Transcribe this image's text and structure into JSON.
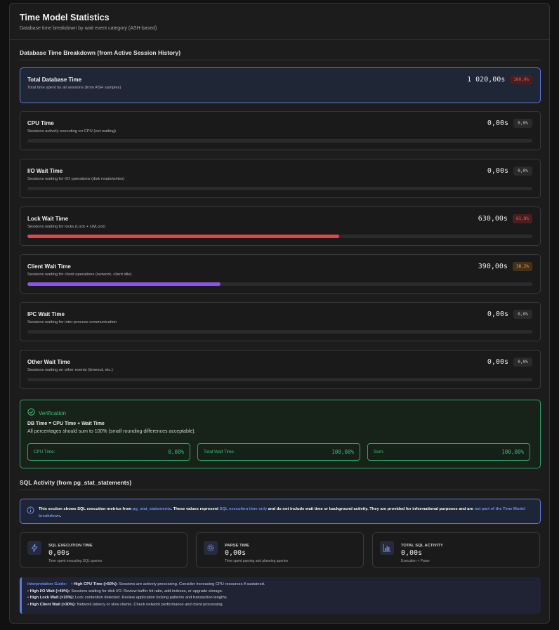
{
  "header": {
    "title": "Time Model Statistics",
    "subtitle": "Database time breakdown by wait event category (ASH-based)"
  },
  "breakdown": {
    "title": "Database Time Breakdown (from Active Session History)",
    "total": {
      "label": "Total Database Time",
      "desc": "Total time spent by all sessions (from ASH samples)",
      "value": "1 020,00s",
      "pct": "100,0%"
    },
    "items": [
      {
        "label": "CPU Time",
        "desc": "Sessions actively executing on CPU (not waiting)",
        "value": "0,00s",
        "pct": "0,0%",
        "fraction": 0,
        "color": "#3b82f6"
      },
      {
        "label": "I/O Wait Time",
        "desc": "Sessions waiting for I/O operations (disk reads/writes)",
        "value": "0,00s",
        "pct": "0,0%",
        "fraction": 0,
        "color": "#f59e0b"
      },
      {
        "label": "Lock Wait Time",
        "desc": "Sessions waiting for locks (Lock + LWLock)",
        "value": "630,00s",
        "pct": "61,8%",
        "fraction": 0.618,
        "color": "#e04848"
      },
      {
        "label": "Client Wait Time",
        "desc": "Sessions waiting for client operations (network, client idle)",
        "value": "390,00s",
        "pct": "38,2%",
        "fraction": 0.382,
        "color": "#8b55e8"
      },
      {
        "label": "IPC Wait Time",
        "desc": "Sessions waiting for inter-process communication",
        "value": "0,00s",
        "pct": "0,0%",
        "fraction": 0,
        "color": "#14b8a6"
      },
      {
        "label": "Other Wait Time",
        "desc": "Sessions waiting on other events (timeout, etc.)",
        "value": "0,00s",
        "pct": "0,0%",
        "fraction": 0,
        "color": "#9ca3af"
      }
    ]
  },
  "verification": {
    "title": "Verification",
    "formula": "DB Time = CPU Time + Wait Time",
    "note": "All percentages should sum to 100% (small rounding differences acceptable).",
    "boxes": [
      {
        "label": "CPU Time:",
        "value": "0,00%"
      },
      {
        "label": "Total Wait Time:",
        "value": "100,00%"
      },
      {
        "label": "Sum:",
        "value": "100,00%"
      }
    ]
  },
  "sql_activity": {
    "title": "SQL Activity (from pg_stat_statements)",
    "info": {
      "t1": "This section shows SQL execution metrics from ",
      "h1": "pg_stat_statements",
      "t2": ". These values represent ",
      "h2": "SQL execution time only",
      "t3": " and do not include wait time or background activity. They are provided for informational purposes and are ",
      "h3": "not part of the Time Model breakdown",
      "t4": "."
    },
    "stats": [
      {
        "label": "SQL EXECUTION TIME",
        "value": "0,00s",
        "desc": "Time spent executing SQL queries",
        "icon": "lightning-icon"
      },
      {
        "label": "PARSE TIME",
        "value": "0,00s",
        "desc": "Time spent parsing and planning queries",
        "icon": "gear-icon"
      },
      {
        "label": "TOTAL SQL ACTIVITY",
        "value": "0,00s",
        "desc": "Execution + Parse",
        "icon": "bar-chart-icon"
      }
    ]
  },
  "guide": {
    "title": "Interpretation Guide:",
    "lines": [
      {
        "term": "High CPU Time (>50%):",
        "text": " Sessions are actively processing. Consider increasing CPU resources if sustained."
      },
      {
        "term": "High I/O Wait (>40%):",
        "text": " Sessions waiting for disk I/O. Review buffer hit ratio, add indexes, or upgrade storage."
      },
      {
        "term": "High Lock Wait (>10%):",
        "text": " Lock contention detected. Review application locking patterns and transaction lengths."
      },
      {
        "term": "High Client Wait (>30%):",
        "text": " Network latency or slow clients. Check network performance and client processing."
      }
    ]
  },
  "colors": {
    "accent": "#5b7be0",
    "success": "#37c173",
    "danger": "#e04848",
    "warning": "#f0a93b"
  }
}
